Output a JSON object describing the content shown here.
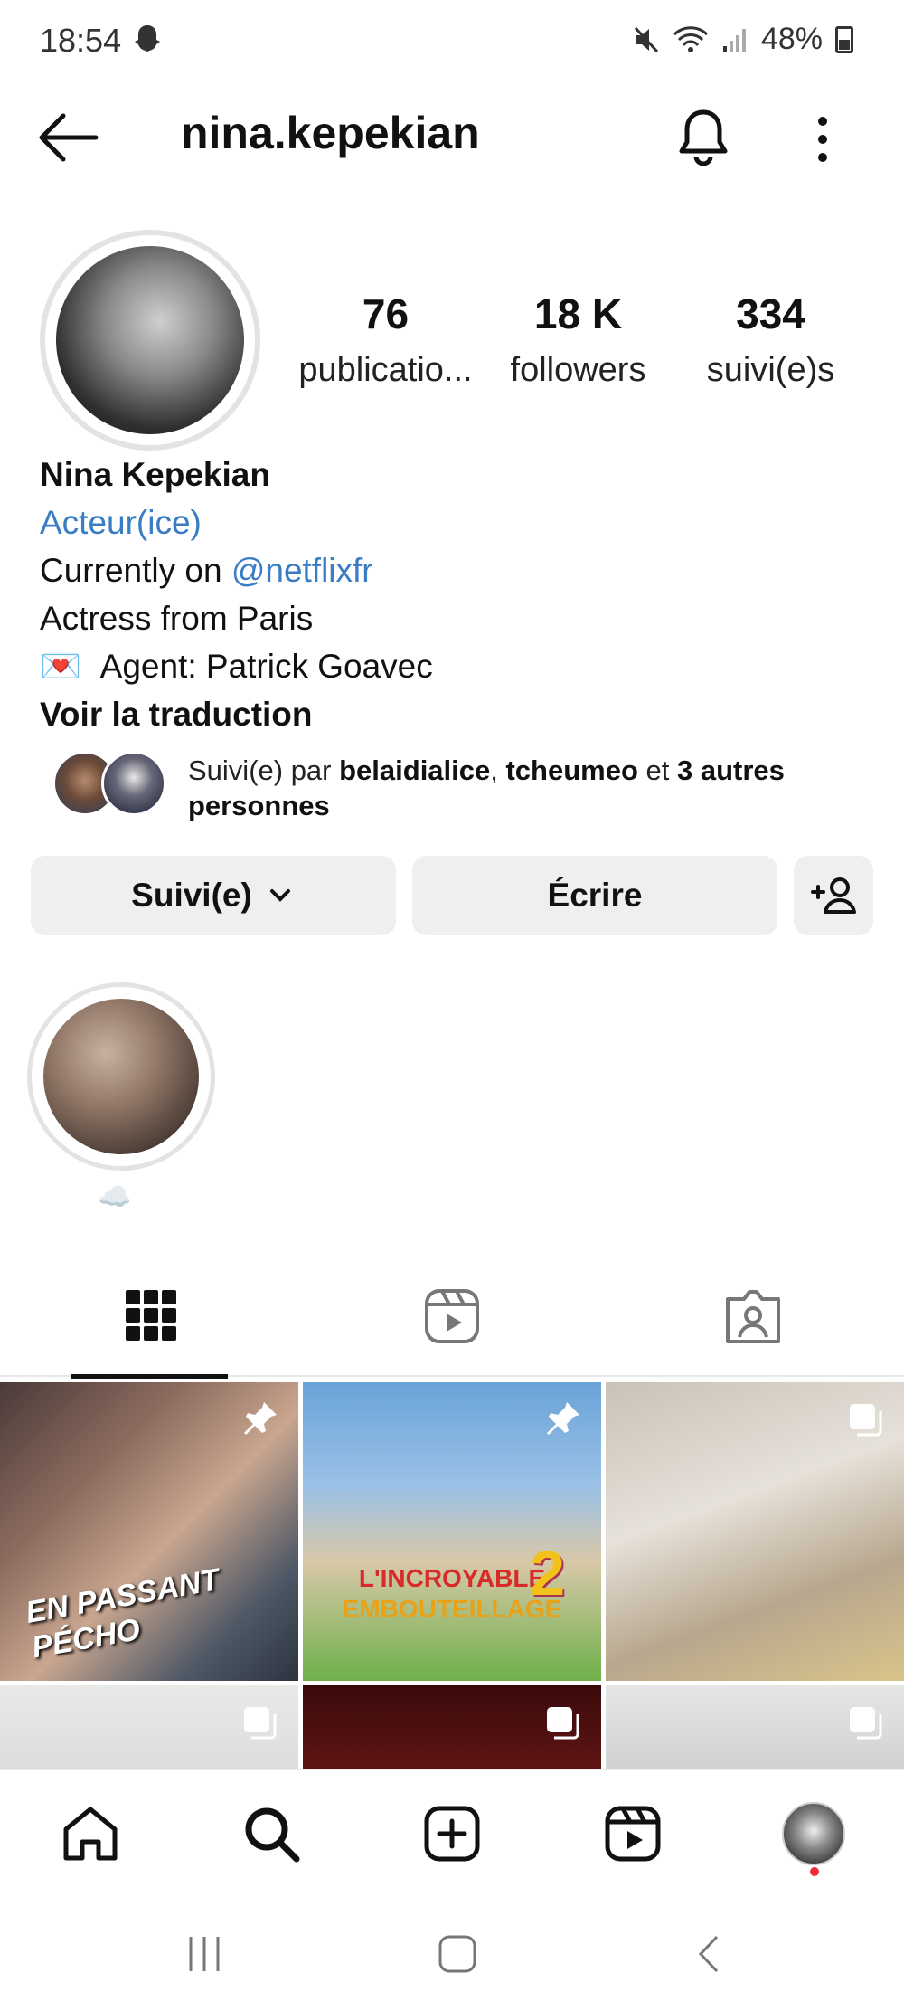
{
  "status_bar": {
    "time": "18:54",
    "battery": "48%"
  },
  "header": {
    "username": "nina.kepekian"
  },
  "stats": [
    {
      "value": "76",
      "label": "publicatio..."
    },
    {
      "value": "18 K",
      "label": "followers"
    },
    {
      "value": "334",
      "label": "suivi(e)s"
    }
  ],
  "bio": {
    "name": "Nina Kepekian",
    "category": "Acteur(ice)",
    "line1_prefix": "Currently on ",
    "line1_mention": "@netflixfr",
    "line2": "Actress from Paris",
    "line3_emoji": "💌",
    "line3": "Agent: Patrick Goavec",
    "translate": "Voir la traduction"
  },
  "followed_by": {
    "prefix": "Suivi(e) par ",
    "user1": "belaidialice",
    "sep": ", ",
    "user2": "tcheumeo",
    "middle": " et ",
    "others": "3 autres personnes"
  },
  "actions": {
    "follow_label": "Suivi(e)",
    "message_label": "Écrire"
  },
  "highlight": {
    "label": "☁️"
  },
  "grid": {
    "post1_text": "EN PASSANT PÉCHO",
    "post2_line1": "L'INCROYABLE",
    "post2_line2": "EMBOUTEILLAGE",
    "post2_number": "2"
  },
  "colors": {
    "link": "#3b7dc4",
    "button_bg": "#efefef",
    "notification_dot": "#ed2b3b"
  },
  "icons": {
    "back": "arrow-left-icon",
    "bell": "bell-icon",
    "more": "more-vertical-icon",
    "add_person": "add-person-icon",
    "grid_tab": "grid-icon",
    "reels_tab": "reels-icon",
    "tagged_tab": "tagged-icon",
    "home": "home-icon",
    "search": "search-icon",
    "create": "plus-square-icon",
    "reels": "reels-icon",
    "profile": "avatar"
  }
}
